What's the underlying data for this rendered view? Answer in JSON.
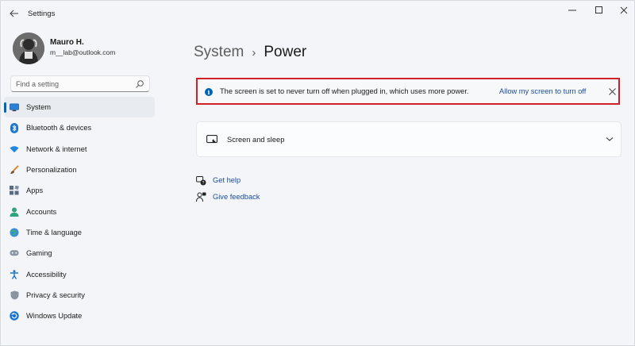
{
  "window": {
    "title": "Settings",
    "controls": {
      "minimize": "—",
      "maximize": "☐",
      "close": "✕"
    }
  },
  "user": {
    "name": "Mauro H.",
    "email": "m__lab@outlook.com"
  },
  "search": {
    "placeholder": "Find a setting"
  },
  "sidebar": {
    "active_index": 0,
    "items": [
      {
        "label": "System",
        "icon": "monitor-icon"
      },
      {
        "label": "Bluetooth & devices",
        "icon": "bluetooth-icon"
      },
      {
        "label": "Network & internet",
        "icon": "wifi-icon"
      },
      {
        "label": "Personalization",
        "icon": "brush-icon"
      },
      {
        "label": "Apps",
        "icon": "apps-icon"
      },
      {
        "label": "Accounts",
        "icon": "person-icon"
      },
      {
        "label": "Time & language",
        "icon": "globe-clock-icon"
      },
      {
        "label": "Gaming",
        "icon": "gamepad-icon"
      },
      {
        "label": "Accessibility",
        "icon": "accessibility-icon"
      },
      {
        "label": "Privacy & security",
        "icon": "shield-icon"
      },
      {
        "label": "Windows Update",
        "icon": "update-icon"
      }
    ]
  },
  "breadcrumb": {
    "parent": "System",
    "separator": "›",
    "current": "Power"
  },
  "banner": {
    "message": "The screen is set to never turn off when plugged in, which uses more power.",
    "action": "Allow my screen to turn off",
    "close": "✕",
    "highlight_color": "#d0202a"
  },
  "card": {
    "label": "Screen and sleep"
  },
  "links": {
    "help": "Get help",
    "feedback": "Give feedback"
  },
  "colors": {
    "accent": "#0067c0",
    "link": "#1a4d9e"
  }
}
